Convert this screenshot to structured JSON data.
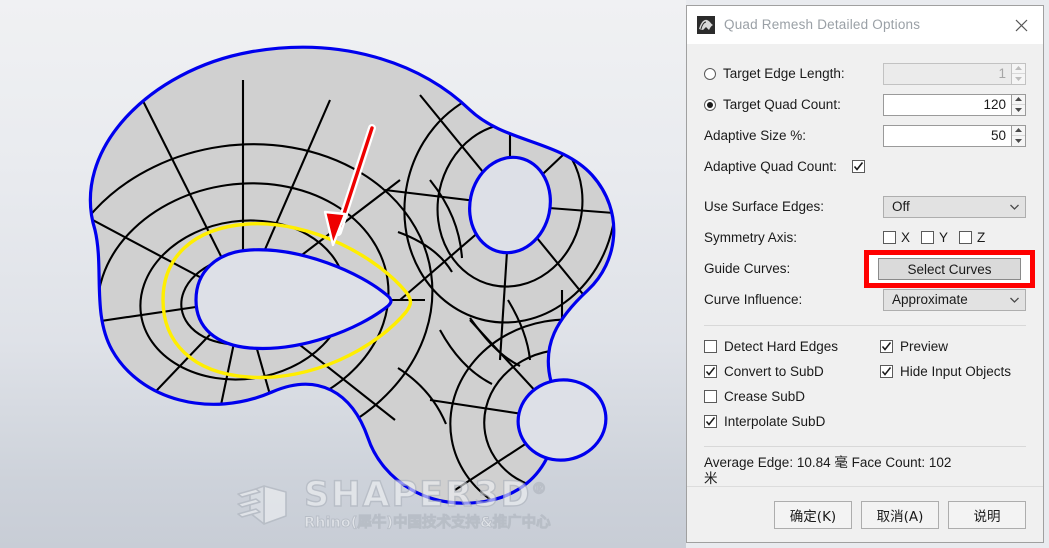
{
  "viewport": {
    "name": "rhino-viewport",
    "watermark": {
      "title": "SHAPER3D",
      "registered": "®",
      "subtitle": "Rhino(犀牛)中国技术支持&推广中心"
    },
    "colors": {
      "mesh_fill": "#d0d0d0",
      "mesh_edge": "#000000",
      "boundary_curve": "#0000ee",
      "guide_curve": "#ffee00",
      "annotation_arrow": "#ee0000",
      "background_top": "#f0f1f3",
      "background_bottom": "#c8cdd6"
    }
  },
  "dialog": {
    "title": "Quad Remesh Detailed Options",
    "icon": "rhino-app-icon",
    "close_label": "×",
    "fields": {
      "target_edge_length": {
        "label": "Target Edge Length:",
        "value": "1",
        "selected": false,
        "enabled": false
      },
      "target_quad_count": {
        "label": "Target Quad Count:",
        "value": "120",
        "selected": true,
        "enabled": true
      },
      "adaptive_size": {
        "label": "Adaptive Size %:",
        "value": "50"
      },
      "adaptive_quad_count": {
        "label": "Adaptive Quad Count:",
        "checked": true
      },
      "use_surface_edges": {
        "label": "Use Surface Edges:",
        "value": "Off"
      },
      "symmetry_axis": {
        "label": "Symmetry Axis:",
        "axes": [
          {
            "label": "X",
            "checked": false
          },
          {
            "label": "Y",
            "checked": false
          },
          {
            "label": "Z",
            "checked": false
          }
        ]
      },
      "guide_curves": {
        "label": "Guide Curves:",
        "button_label": "Select Curves",
        "highlighted": true,
        "highlight_color": "#ff0000"
      },
      "curve_influence": {
        "label": "Curve Influence:",
        "value": "Approximate"
      }
    },
    "options": [
      {
        "label": "Detect Hard Edges",
        "checked": false
      },
      {
        "label": "Preview",
        "checked": true
      },
      {
        "label": "Convert to SubD",
        "checked": true
      },
      {
        "label": "Hide Input Objects",
        "checked": true
      },
      {
        "label": "Crease SubD",
        "checked": false
      },
      {
        "label": "Interpolate SubD",
        "checked": true
      }
    ],
    "status": {
      "line1": "Average Edge:  10.84 毫  Face Count:  102",
      "line2": "米"
    },
    "buttons": [
      {
        "label": "确定(K)",
        "name": "ok-button"
      },
      {
        "label": "取消(A)",
        "name": "cancel-button"
      },
      {
        "label": "说明",
        "name": "help-button"
      }
    ]
  }
}
